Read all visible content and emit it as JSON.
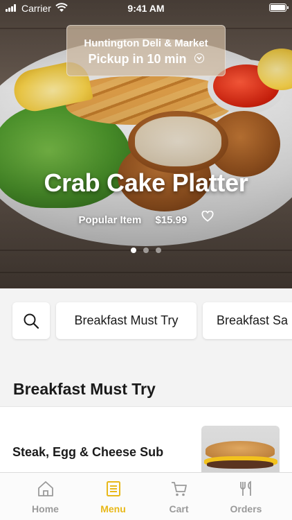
{
  "status_bar": {
    "carrier": "Carrier",
    "time": "9:41 AM"
  },
  "store": {
    "name": "Huntington Deli & Market",
    "pickup": "Pickup in 10 min"
  },
  "featured": {
    "title": "Crab Cake Platter",
    "tag": "Popular Item",
    "price": "$15.99",
    "carousel_pages": 3,
    "carousel_active_index": 0
  },
  "categories": {
    "chips": [
      "Breakfast Must Try",
      "Breakfast Sa"
    ]
  },
  "section": {
    "title": "Breakfast Must Try",
    "items": [
      {
        "name": "Steak, Egg & Cheese Sub"
      }
    ]
  },
  "tab_bar": {
    "tabs": [
      {
        "label": "Home",
        "icon": "home-icon"
      },
      {
        "label": "Menu",
        "icon": "menu-icon"
      },
      {
        "label": "Cart",
        "icon": "cart-icon"
      },
      {
        "label": "Orders",
        "icon": "fork-knife-icon"
      }
    ],
    "active": "Menu"
  },
  "colors": {
    "accent": "#e8b819",
    "inactive_tab": "#9a9a9a",
    "background": "#f3f3f3"
  }
}
